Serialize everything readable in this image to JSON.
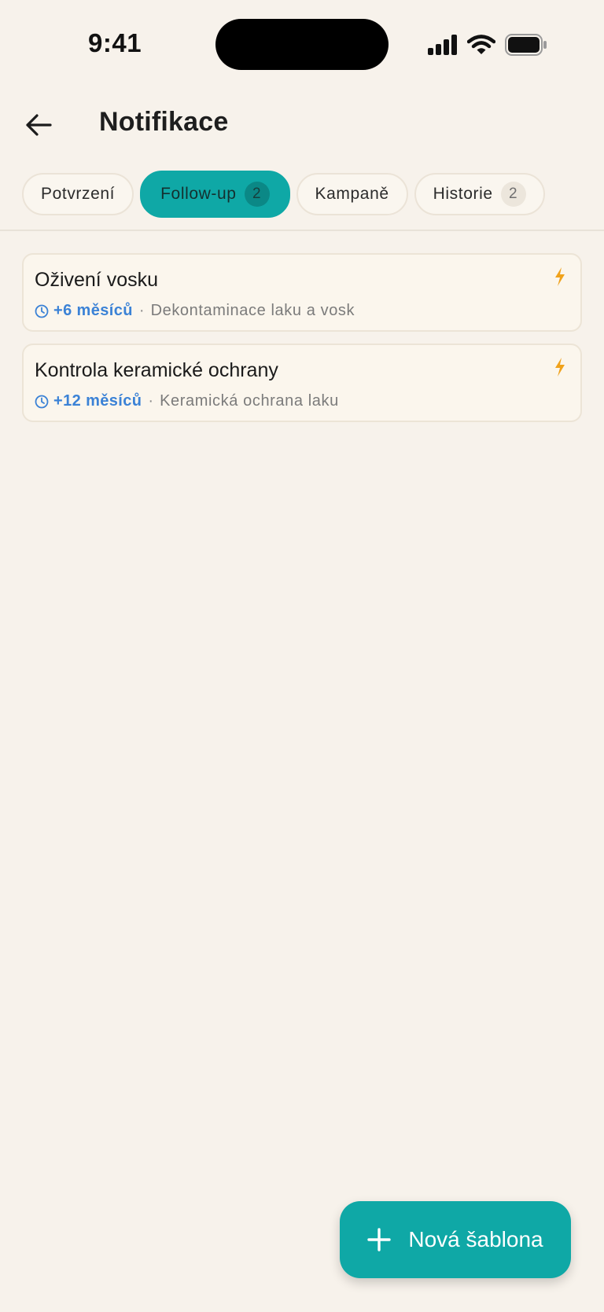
{
  "status_bar": {
    "time": "9:41",
    "icons": [
      "cellular-signal-icon",
      "wifi-icon",
      "battery-icon"
    ]
  },
  "header": {
    "back_icon": "arrow-left-icon",
    "title": "Notifikace"
  },
  "tabs": [
    {
      "label": "Potvrzení",
      "badge": null,
      "active": false
    },
    {
      "label": "Follow-up",
      "badge": "2",
      "active": true
    },
    {
      "label": "Kampaně",
      "badge": null,
      "active": false
    },
    {
      "label": "Historie",
      "badge": "2",
      "active": false
    }
  ],
  "templates": [
    {
      "title": "Oživení vosku",
      "interval": "+6 měsíců",
      "separator": "·",
      "service": "Dekontaminace laku a vosk",
      "icon": "lightning-bolt-icon"
    },
    {
      "title": "Kontrola keramické ochrany",
      "interval": "+12 měsíců",
      "separator": "·",
      "service": "Keramická ochrana laku",
      "icon": "lightning-bolt-icon"
    }
  ],
  "fab": {
    "icon": "plus-icon",
    "label": "Nová šablona"
  },
  "colors": {
    "background": "#f7f2eb",
    "accent": "#0fa8a6",
    "interval_text": "#3b82d6",
    "bolt": "#f0a21b"
  }
}
